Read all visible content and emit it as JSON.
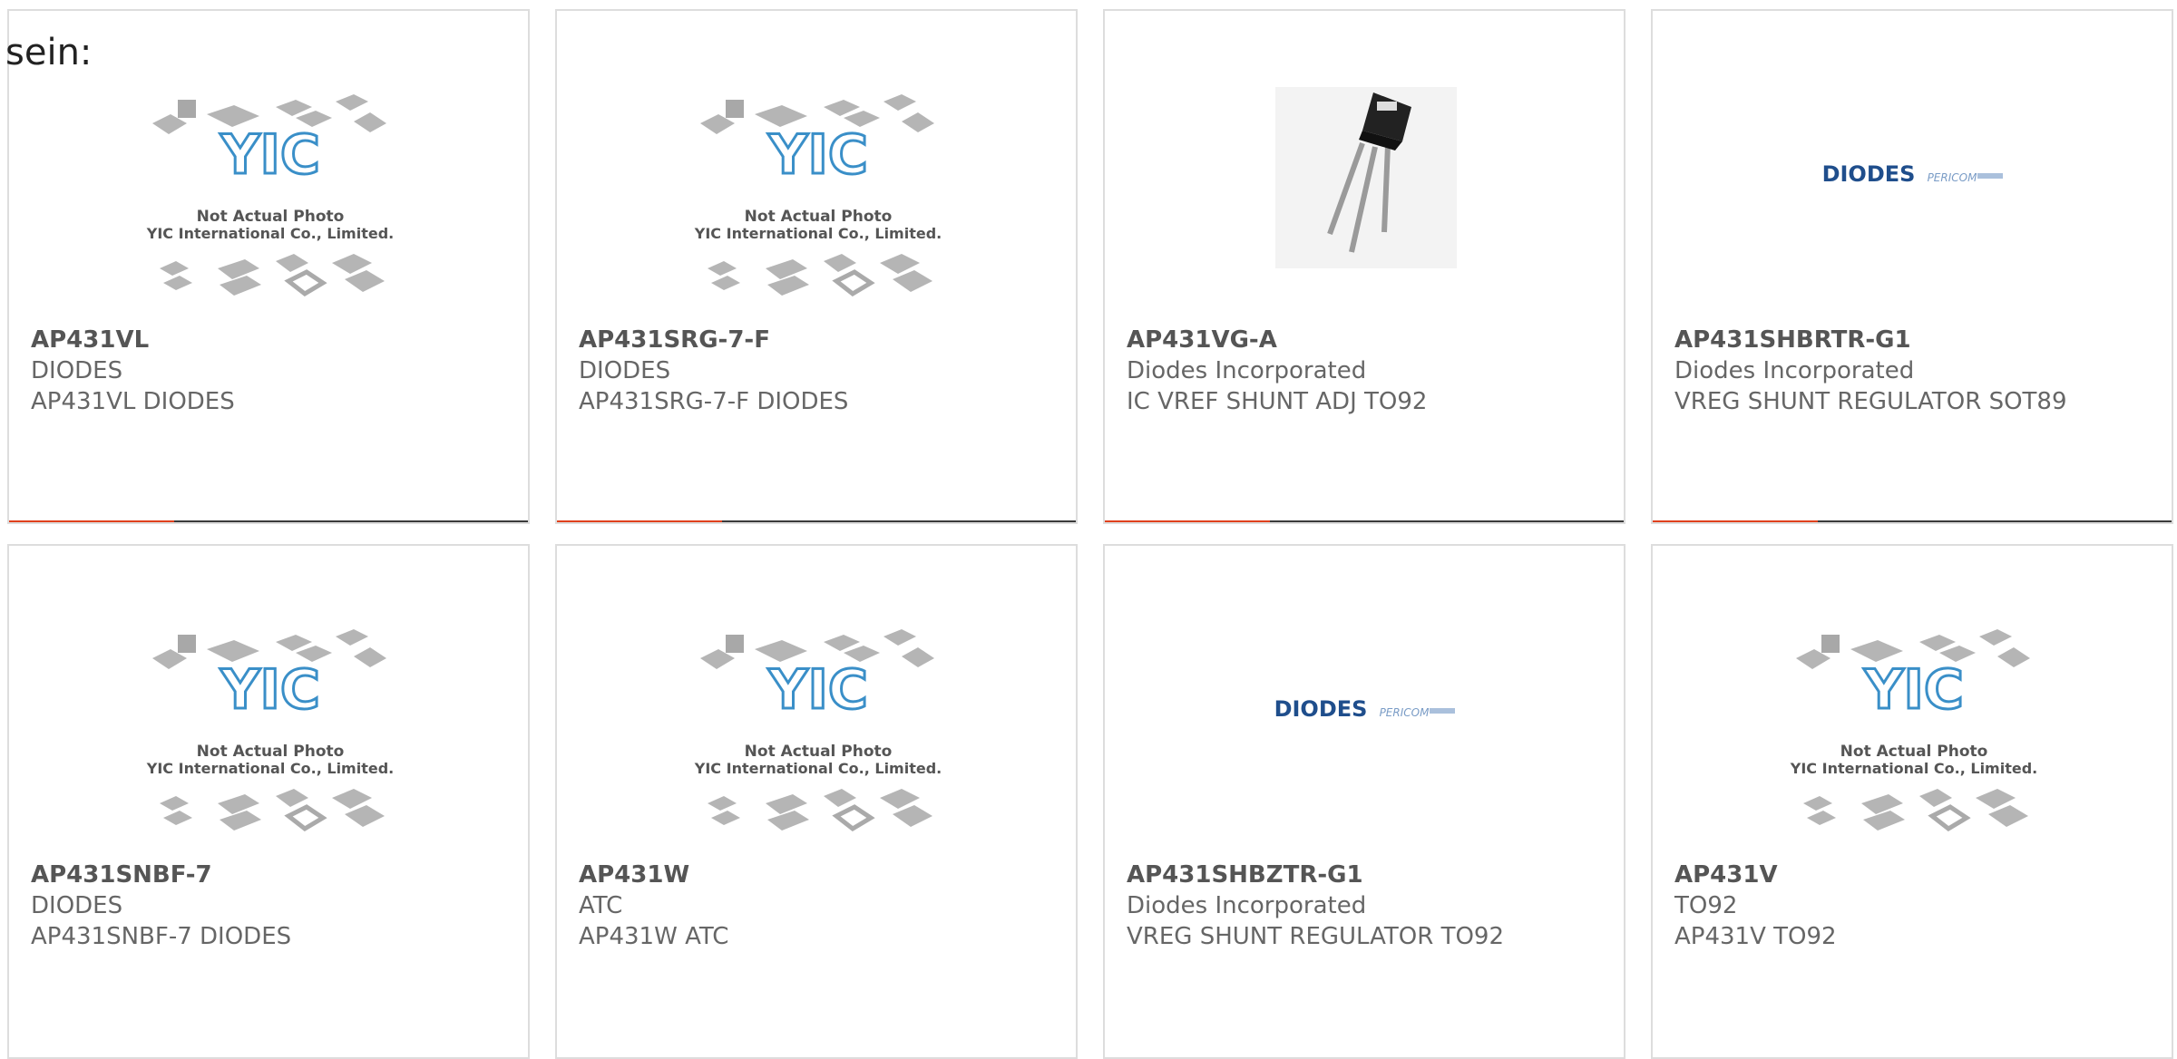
{
  "intro_text": "sein:",
  "colors": {
    "accent": "#e0401c",
    "bar_rest": "#3a3a3a",
    "border": "#dddddd",
    "text": "#666666"
  },
  "placeholder": {
    "line1": "Not Actual Photo",
    "line2": "YIC International Co., Limited.",
    "logo_text": "YIC"
  },
  "brand_logo": {
    "brand": "DIODES",
    "sub": "PERICOM"
  },
  "cards": [
    {
      "part": "AP431VL",
      "maker": "DIODES",
      "desc": "AP431VL DIODES",
      "image": "yic-placeholder"
    },
    {
      "part": "AP431SRG-7-F",
      "maker": "DIODES",
      "desc": "AP431SRG-7-F DIODES",
      "image": "yic-placeholder"
    },
    {
      "part": "AP431VG-A",
      "maker": "Diodes Incorporated",
      "desc": "IC VREF SHUNT ADJ TO92",
      "image": "to92-photo"
    },
    {
      "part": "AP431SHBRTR-G1",
      "maker": "Diodes Incorporated",
      "desc": "VREG SHUNT REGULATOR SOT89",
      "image": "diodes-logo"
    },
    {
      "part": "AP431SNBF-7",
      "maker": "DIODES",
      "desc": "AP431SNBF-7 DIODES",
      "image": "yic-placeholder"
    },
    {
      "part": "AP431W",
      "maker": "ATC",
      "desc": "AP431W ATC",
      "image": "yic-placeholder"
    },
    {
      "part": "AP431SHBZTR-G1",
      "maker": "Diodes Incorporated",
      "desc": "VREG SHUNT REGULATOR TO92",
      "image": "diodes-logo"
    },
    {
      "part": "AP431V",
      "maker": "TO92",
      "desc": "AP431V TO92",
      "image": "yic-placeholder"
    }
  ]
}
